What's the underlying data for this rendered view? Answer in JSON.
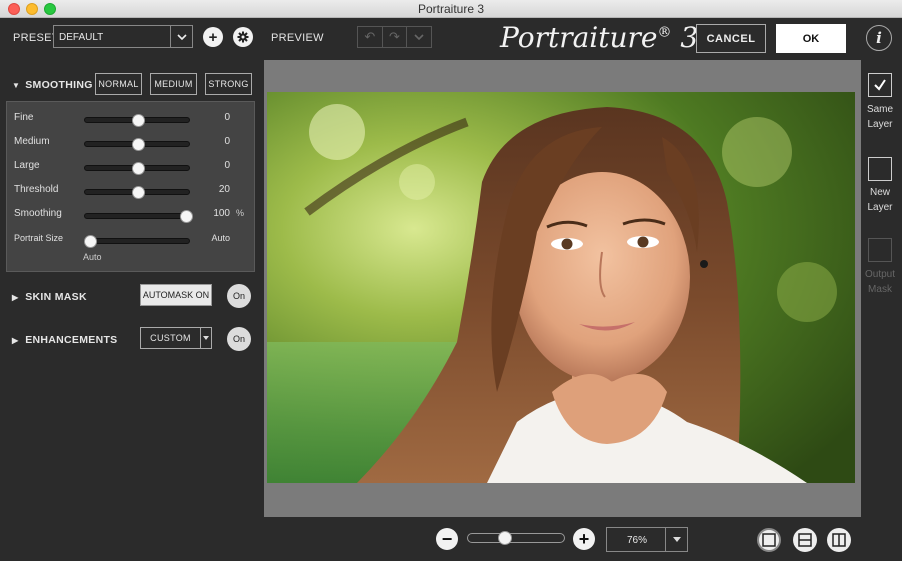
{
  "window": {
    "title": "Portraiture 3"
  },
  "toolbar": {
    "preset_label": "PRESET",
    "preset_value": "DEFAULT",
    "preview_label": "PREVIEW",
    "logo_text": "Portraiture",
    "logo_mark": "®",
    "logo_version": "3",
    "cancel_label": "CANCEL",
    "ok_label": "OK",
    "info_label": "i"
  },
  "smoothing": {
    "title": "SMOOTHING",
    "presets": [
      "NORMAL",
      "MEDIUM",
      "STRONG"
    ],
    "sliders": [
      {
        "label": "Fine",
        "value": "0",
        "fraction": 0.5,
        "unit": ""
      },
      {
        "label": "Medium",
        "value": "0",
        "fraction": 0.5,
        "unit": ""
      },
      {
        "label": "Large",
        "value": "0",
        "fraction": 0.5,
        "unit": ""
      },
      {
        "label": "Threshold",
        "value": "20",
        "fraction": 0.5,
        "unit": ""
      },
      {
        "label": "Smoothing",
        "value": "100",
        "fraction": 0.95,
        "unit": "%"
      }
    ],
    "portrait_size": {
      "label": "Portrait Size",
      "value": "Auto",
      "fraction": 0.05,
      "below": "Auto"
    }
  },
  "skin_mask": {
    "title": "SKIN MASK",
    "button": "AUTOMASK ON",
    "toggle": "On"
  },
  "enhancements": {
    "title": "ENHANCEMENTS",
    "button": "CUSTOM",
    "toggle": "On"
  },
  "output": {
    "same_layer": "Same Layer",
    "new_layer": "New Layer",
    "output_mask": "Output Mask",
    "selected": "same_layer"
  },
  "zoom": {
    "value": "76%",
    "slider_fraction": 0.38
  },
  "colors": {
    "accent_white": "#ffffff",
    "panel": "#444444",
    "bg": "#2b2b2b"
  }
}
